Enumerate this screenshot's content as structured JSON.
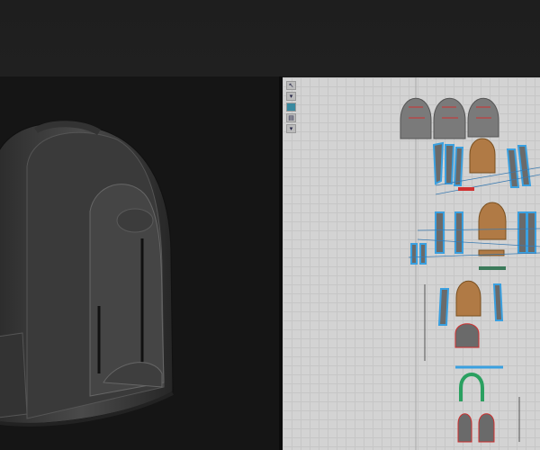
{
  "app": {
    "panels": [
      "3d-viewport",
      "2d-pattern-window"
    ]
  },
  "toolbar": {
    "icons": [
      "select-move-icon",
      "transform-icon",
      "fold-icon",
      "edit-pattern-icon",
      "pin-icon"
    ]
  },
  "colors": {
    "background": "#151515",
    "pattern_bg": "#d3d3d3",
    "piece_gray": "#7a7a7a",
    "piece_orange": "#b07a45",
    "selection_blue": "#3aa0e0",
    "seam_red": "#d03030"
  }
}
